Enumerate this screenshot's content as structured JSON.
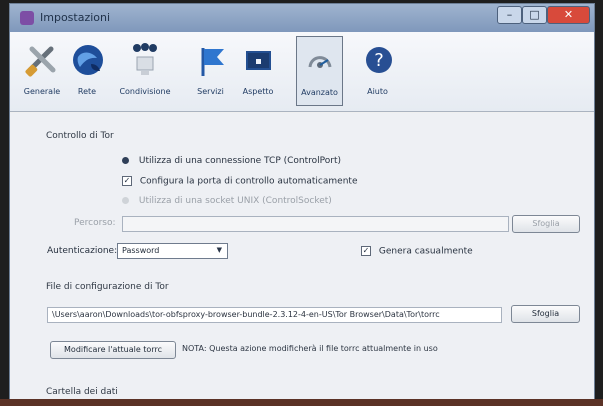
{
  "window": {
    "title": "Impostazioni"
  },
  "toolbar": {
    "items": [
      {
        "label": "Generale",
        "icon": "tools-icon"
      },
      {
        "label": "Rete",
        "icon": "network-globe-icon"
      },
      {
        "label": "Condivisione",
        "icon": "sharing-icon"
      },
      {
        "label": "Servizi",
        "icon": "flag-icon"
      },
      {
        "label": "Aspetto",
        "icon": "appearance-icon"
      },
      {
        "label": "Avanzato",
        "icon": "advanced-icon"
      },
      {
        "label": "Aiuto",
        "icon": "help-icon"
      }
    ]
  },
  "settings": {
    "tor_control_title": "Controllo di Tor",
    "tcp_option": "Utilizza di una connessione TCP (ControlPort)",
    "auto_config": "Configura la porta di controllo automaticamente",
    "unix_option": "Utilizza di una socket UNIX (ControlSocket)",
    "file_label": "Percorso:",
    "browse_disabled": "Sfoglia",
    "auth_label": "Autenticazione:",
    "auth_value": "Password",
    "random_label": "Genera casualmente",
    "config_title": "File di configurazione di Tor",
    "config_path": "\\Users\\aaron\\Downloads\\tor-obfsproxy-browser-bundle-2.3.12-4-en-US\\Tor Browser\\Data\\Tor\\torrc",
    "config_browse": "Sfoglia",
    "modify_button": "Modificare l'attuale torrc",
    "note": "NOTA: Questa azione modificherà il file torrc attualmente in uso",
    "data_folder_title": "Cartella dei dati"
  },
  "colors": {
    "window_bg": "#f0f0f0",
    "title_bar": "#8aa4c8",
    "accent": "#2f76cf",
    "close_button": "#d84a3b"
  }
}
